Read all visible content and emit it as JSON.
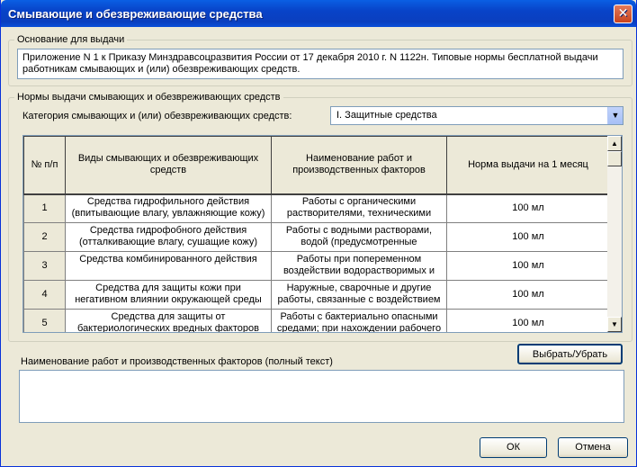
{
  "window": {
    "title": "Смывающие и обезвреживающие средства",
    "close_glyph": "✕"
  },
  "basis": {
    "legend": "Основание для выдачи",
    "text": "Приложение N 1 к Приказу Минздравсоцразвития России от 17 декабря 2010 г. N 1122н. Типовые нормы бесплатной выдачи работникам смывающих и (или) обезвреживающих средств."
  },
  "norms": {
    "legend": "Нормы выдачи смывающих и обезвреживающих средств",
    "category_label": "Категория смывающих и (или) обезвреживающих средств:",
    "category_value": "I. Защитные средства",
    "table": {
      "headers": [
        "№ п/п",
        "Виды смывающих и обезвреживающих средств",
        "Наименование работ и производственных факторов",
        "Норма выдачи на 1 месяц"
      ],
      "rows": [
        {
          "num": "1",
          "kind": "Средства гидрофильного действия (впитывающие влагу, увлажняющие кожу)",
          "works": "Работы с органическими растворителями, техническими",
          "norm": "100 мл"
        },
        {
          "num": "2",
          "kind": "Средства гидрофобного действия (отталкивающие влагу, сушащие кожу)",
          "works": "Работы с водными растворами, водой (предусмотренные",
          "norm": "100 мл"
        },
        {
          "num": "3",
          "kind": "Средства комбинированного действия",
          "works": "Работы при попеременном воздействии водорастворимых и",
          "norm": "100 мл"
        },
        {
          "num": "4",
          "kind": "Средства для защиты кожи при негативном влиянии окружающей среды",
          "works": "Наружные, сварочные и другие работы, связанные с воздействием",
          "norm": "100 мл"
        },
        {
          "num": "5",
          "kind": "Средства для защиты от бактериологических вредных факторов",
          "works": "Работы с бактериально опасными средами; при нахождении рабочего",
          "norm": "100 мл"
        }
      ]
    },
    "scroll_up": "▲",
    "scroll_down": "▼",
    "combo_arrow": "▼",
    "select_button": "Выбрать/Убрать"
  },
  "full_text": {
    "label": "Наименование работ и производственных факторов (полный текст)",
    "value": ""
  },
  "buttons": {
    "ok": "ОК",
    "cancel": "Отмена"
  }
}
